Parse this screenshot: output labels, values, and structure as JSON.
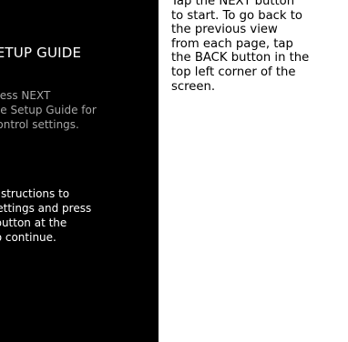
{
  "screen": {
    "title": "SETUP GUIDE",
    "intro": "Press NEXT\nthe Setup Guide for\nControl settings.",
    "instructions": "instructions to\nsettings and press\n-button at the\nto continue."
  },
  "help_callout": {
    "text": "Tap the NEXT button\nto start. To go back to\nthe previous view\nfrom each page, tap\nthe BACK button in the\ntop left corner of the\nscreen."
  },
  "colors": {
    "screen_background": "#000000",
    "title_text": "#ffffff",
    "intro_text": "#a6a6a6",
    "instructions_text": "#ffffff",
    "callout_text": "#000000"
  }
}
